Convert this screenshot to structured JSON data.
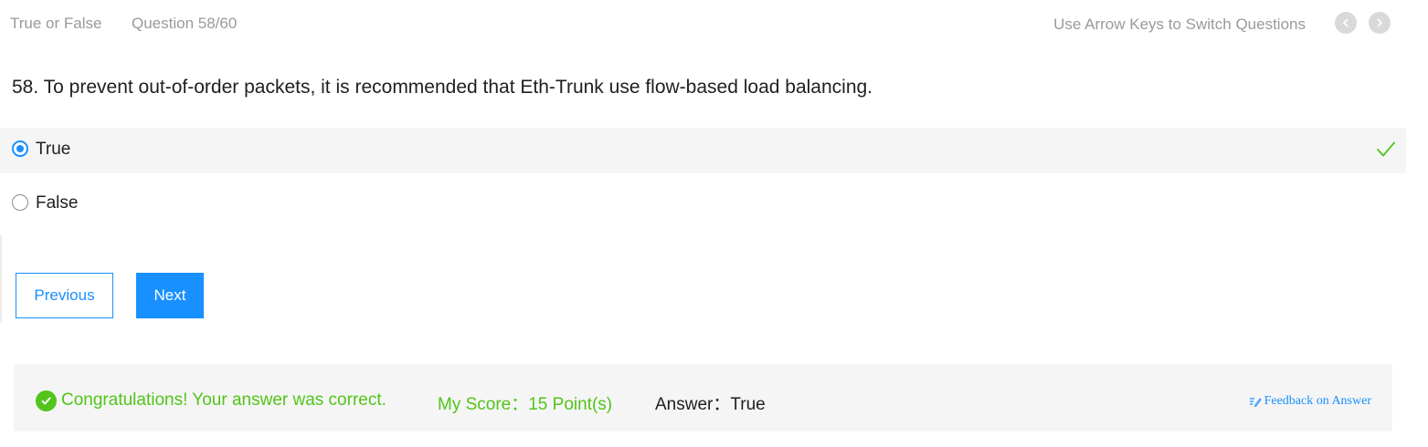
{
  "header": {
    "type_label": "True or False",
    "counter": "Question 58/60",
    "hint": "Use Arrow Keys to Switch Questions"
  },
  "question": {
    "text": "58. To prevent out-of-order packets, it is recommended that Eth-Trunk use flow-based load balancing."
  },
  "options": [
    {
      "label": "True",
      "selected": true,
      "correct": true
    },
    {
      "label": "False",
      "selected": false,
      "correct": false
    }
  ],
  "buttons": {
    "previous": "Previous",
    "next": "Next"
  },
  "result": {
    "message": "Congratulations! Your answer was correct.",
    "score": "My Score：15 Point(s)",
    "answer": "Answer：True",
    "feedback": "Feedback on Answer"
  },
  "colors": {
    "accent": "#1890ff",
    "success": "#52c41a",
    "muted": "#9a9a9a"
  },
  "icons": {
    "prev": "chevron-left-icon",
    "next": "chevron-right-icon",
    "correct": "checkmark-icon",
    "success": "check-circle-icon",
    "feedback": "edit-icon"
  }
}
